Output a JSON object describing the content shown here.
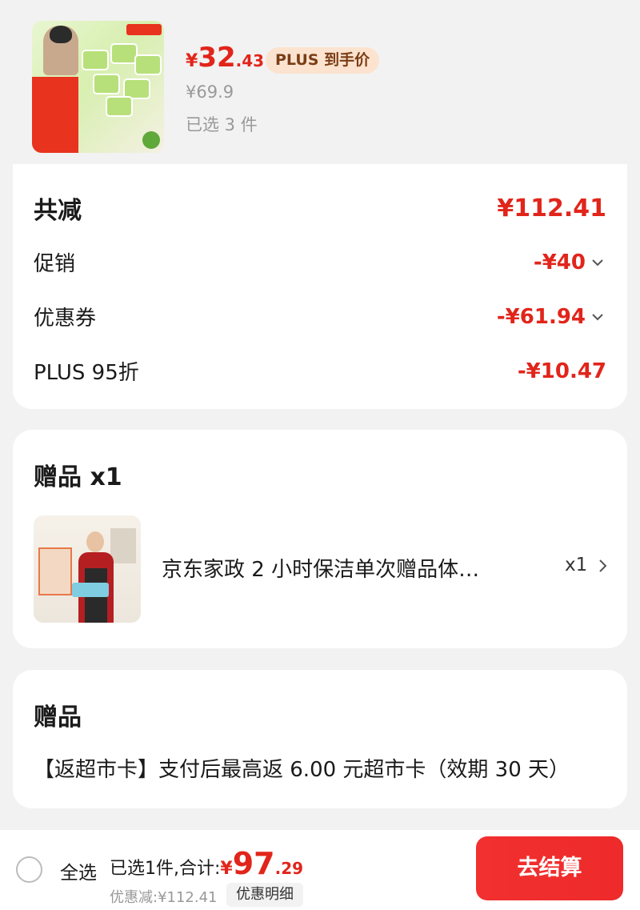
{
  "product": {
    "price_symbol": "¥",
    "price_integer": "32",
    "price_decimal": ".43",
    "plus_tag": "PLUS 到手价",
    "original_price": "¥69.9",
    "selected": "已选 3 件"
  },
  "discount": {
    "total_label": "共减",
    "total_amount": "¥112.41",
    "rows": [
      {
        "label": "促销",
        "amount": "-¥40",
        "expandable": true
      },
      {
        "label": "优惠券",
        "amount": "-¥61.94",
        "expandable": true
      },
      {
        "label": "PLUS 95折",
        "amount": "-¥10.47",
        "expandable": false
      }
    ]
  },
  "gift": {
    "title": "赠品 x1",
    "item_name": "京东家政 2 小时保洁单次赠品体…",
    "item_qty": "x1"
  },
  "gift2": {
    "title": "赠品",
    "description": "【返超市卡】支付后最高返 6.00 元超市卡（效期 30 天）"
  },
  "bottom_bar": {
    "select_all": "全选",
    "summary": "已选1件,合计:",
    "total_symbol": "¥",
    "total_integer": "97",
    "total_decimal": ".29",
    "saved": "优惠减:¥112.41",
    "detail_button": "优惠明细",
    "checkout_button": "去结算"
  },
  "colors": {
    "accent": "#e1251b",
    "plus_tag_bg": "#fbe3cf",
    "plus_tag_text": "#7a3d16",
    "background": "#f2f2f2"
  }
}
